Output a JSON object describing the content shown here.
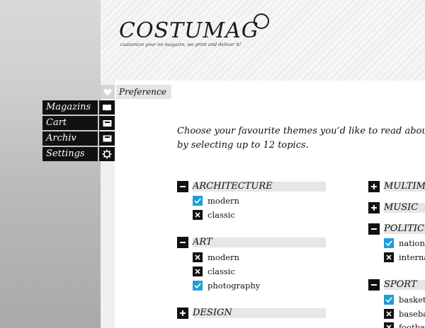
{
  "header": {
    "logo": "COSTUMAG",
    "tagline": "customize your on magazin, we print and deliver it!"
  },
  "nav": [
    {
      "label": "Magazins",
      "icon": "book-icon"
    },
    {
      "label": "Cart",
      "icon": "cart-icon"
    },
    {
      "label": "Archiv",
      "icon": "archive-icon"
    },
    {
      "label": "Settings",
      "icon": "gear-icon"
    }
  ],
  "breadcrumb": {
    "icon": "heart-icon",
    "label": "Preference"
  },
  "intro": {
    "line1": "Choose your favourite themes you’d like to read about",
    "line2": "by selecting up to 12 topics."
  },
  "colors": {
    "checked": "#1e9fd6",
    "unchecked": "#111111",
    "accent_bar": "#e6e6e6"
  },
  "topics_left": [
    {
      "name": "ARCHITECTURE",
      "expanded": true,
      "items": [
        {
          "label": "modern",
          "checked": true
        },
        {
          "label": "classic",
          "checked": false
        }
      ]
    },
    {
      "name": "ART",
      "expanded": true,
      "items": [
        {
          "label": "modern",
          "checked": false
        },
        {
          "label": "classic",
          "checked": false
        },
        {
          "label": "photography",
          "checked": true
        }
      ]
    },
    {
      "name": "DESIGN",
      "expanded": false,
      "items": []
    }
  ],
  "topics_right": [
    {
      "name": "MULTIM",
      "expanded": false,
      "items": []
    },
    {
      "name": "MUSIC",
      "expanded": false,
      "items": []
    },
    {
      "name": "POLITIC",
      "expanded": true,
      "items": [
        {
          "label": "nationa",
          "checked": true
        },
        {
          "label": "interna",
          "checked": false
        }
      ]
    },
    {
      "name": "SPORT",
      "expanded": true,
      "items": [
        {
          "label": "basketb",
          "checked": true
        },
        {
          "label": "basebal",
          "checked": false
        },
        {
          "label": "footbal",
          "checked": false
        }
      ]
    }
  ]
}
